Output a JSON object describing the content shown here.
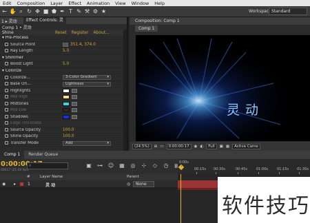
{
  "menu": [
    "Edit",
    "Composition",
    "Layer",
    "Effect",
    "Animation",
    "View",
    "Window",
    "Help"
  ],
  "toolbar": {
    "tools": [
      "←",
      "✋",
      "⌕",
      "↻",
      "✥",
      "■",
      "⬟",
      "✒",
      "T",
      "✎",
      "⚒",
      "⚙",
      "★"
    ],
    "workspace_label": "Workspace:",
    "workspace_value": "Standard"
  },
  "effect_controls": {
    "tab_left": "1 ▸ 灵动",
    "tab": "Effect Controls: 灵",
    "breadcrumb": "Comp 1 • 灵动",
    "effect_name": "Shine",
    "reset": "Reset",
    "register": "Register",
    "about": "About...",
    "rows": [
      {
        "kind": "group",
        "name": "Pre-Process"
      },
      {
        "kind": "point",
        "name": "Source Point",
        "value": "351.4, 374.0"
      },
      {
        "kind": "value",
        "name": "Ray Length",
        "value": "5.0"
      },
      {
        "kind": "group",
        "name": "Shimmer"
      },
      {
        "kind": "value",
        "name": "Boost Light",
        "value": "5.0"
      },
      {
        "kind": "group",
        "name": "Colorize"
      },
      {
        "kind": "dropdown",
        "name": "Colorize...",
        "value": "3-Color Gradient"
      },
      {
        "kind": "dropdown",
        "name": "Base On...",
        "value": "Lightness"
      },
      {
        "kind": "color",
        "name": "Highlights",
        "color": "#ffffff"
      },
      {
        "kind": "color",
        "name": "Mid High",
        "color": "#f2e07e",
        "dim": true
      },
      {
        "kind": "color",
        "name": "Midtones",
        "color": "#35d4ea"
      },
      {
        "kind": "color",
        "name": "Mid Low",
        "color": "#2a2a2a",
        "dim": true
      },
      {
        "kind": "color",
        "name": "Shadows",
        "color": "#1730d8"
      },
      {
        "kind": "check",
        "name": "Edge Thickness",
        "dim": true
      },
      {
        "kind": "value",
        "name": "Source Opacity",
        "value": "100.0"
      },
      {
        "kind": "value",
        "name": "Shine Opacity",
        "value": "100.0"
      },
      {
        "kind": "dropdown",
        "name": "Transfer Mode",
        "value": "Add"
      }
    ]
  },
  "composition": {
    "tab": "Composition: Comp 1",
    "comp_button": "Comp 1",
    "text": "灵  动",
    "zoom": "(24.5%)",
    "timecode": "0:00:00:17",
    "quality": "Full",
    "camera": "Active Came"
  },
  "timeline": {
    "tabs": [
      "Comp 1",
      "Render Queue"
    ],
    "timecode": "0:00:00:17",
    "frames": "00017 (25.00 fps)",
    "search_placeholder": "",
    "ticks": [
      "0:00s",
      "00:15s",
      "00:30s",
      "00:45s",
      "01:00s",
      "01:15s",
      "01:30s"
    ],
    "columns": {
      "num": "#",
      "name": "Layer Name",
      "parent": "Parent"
    },
    "layer": {
      "index": "1",
      "name": "灵 动",
      "parent": "None"
    }
  },
  "watermark": "软件技巧"
}
